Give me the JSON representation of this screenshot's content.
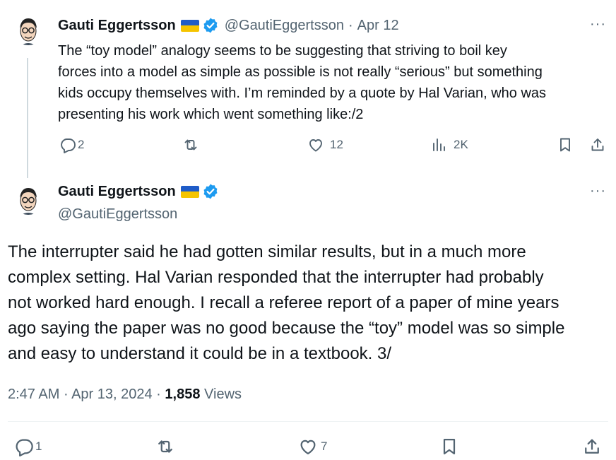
{
  "tweet1": {
    "author_name": "Gauti Eggertsson",
    "handle": "@GautiEggertsson",
    "separator": "·",
    "date": "Apr 12",
    "text": "The “toy model” analogy seems to be suggesting that striving to boil key\nforces into a model as simple as possible is not really “serious” but something\nkids occupy themselves with. I’m reminded by a quote by Hal Varian, who was\npresenting his work which went something like:/2",
    "replies": "2",
    "likes": "12",
    "views": "2K",
    "more_label": "···"
  },
  "tweet2": {
    "author_name": "Gauti Eggertsson",
    "handle": "@GautiEggertsson",
    "text": "The interrupter said he had gotten similar results, but in a much more\ncomplex setting. Hal Varian responded that the interrupter had probably\nnot worked hard enough. I recall a referee report of a paper of mine years\nago saying the paper was no good because the “toy” model was so simple\nand easy to understand it could be in a textbook. 3/",
    "time": "2:47 AM",
    "sep1": "·",
    "date": "Apr 13, 2024",
    "sep2": "·",
    "view_count": "1,858",
    "views_label": "Views",
    "replies": "1",
    "likes": "7",
    "more_label": "···"
  },
  "colors": {
    "verified": "#1d9bf0",
    "muted": "#536471",
    "text": "#0f1419",
    "divider": "#eff3f4",
    "flag_blue": "#1f5cc8",
    "flag_yellow": "#f5c400"
  },
  "icons": [
    "avatar-illustration",
    "ukraine-flag-icon",
    "verified-badge-icon",
    "more-icon",
    "reply-icon",
    "retweet-icon",
    "like-icon",
    "views-icon",
    "bookmark-icon",
    "share-icon"
  ]
}
